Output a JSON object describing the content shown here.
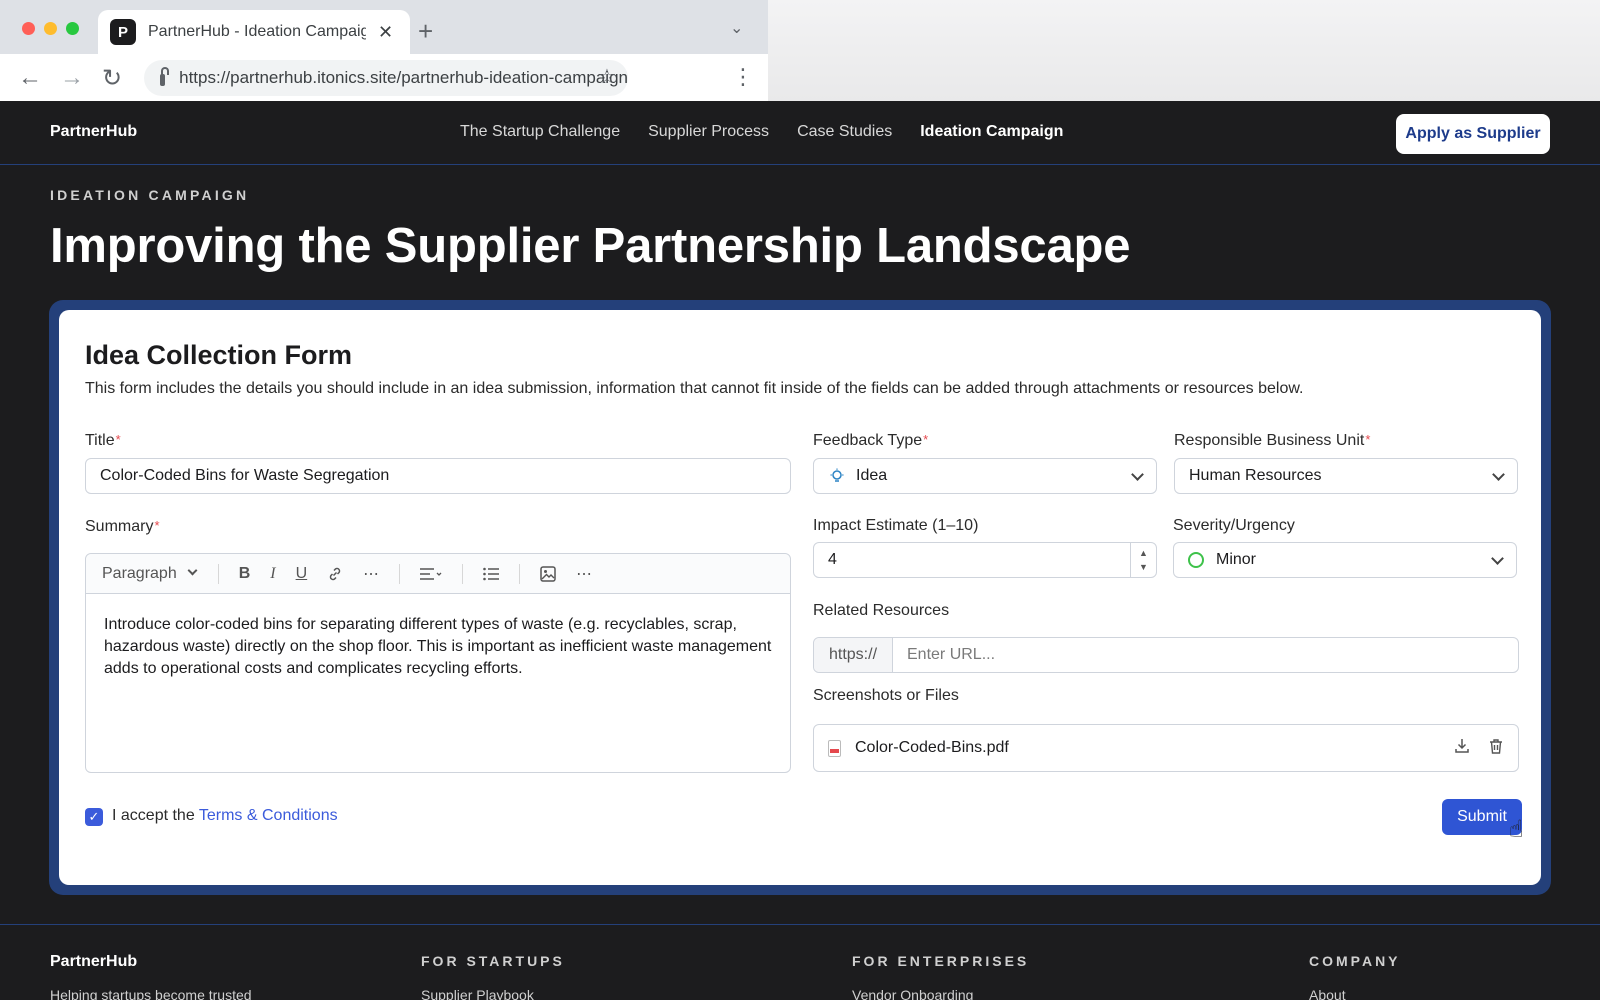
{
  "browser": {
    "tab_title": "PartnerHub - Ideation Campaign",
    "tab_favicon": "P",
    "url": "https://partnerhub.itonics.site/partnerhub-ideation-campaign"
  },
  "header": {
    "brand": "PartnerHub",
    "nav": [
      "The Startup Challenge",
      "Supplier Process",
      "Case Studies",
      "Ideation Campaign"
    ],
    "active_nav": "Ideation Campaign",
    "cta": "Apply as Supplier"
  },
  "hero": {
    "eyebrow": "IDEATION CAMPAIGN",
    "title": "Improving the Supplier Partnership Landscape"
  },
  "form": {
    "title": "Idea Collection Form",
    "description": "This form includes the details you should include in an idea submission, information that cannot fit inside of the fields can be added through attachments or resources below.",
    "title_field": {
      "label": "Title",
      "required_mark": "*",
      "value": "Color-Coded Bins for Waste Segregation"
    },
    "summary": {
      "label": "Summary",
      "required_mark": "*",
      "paragraph_style": "Paragraph",
      "text": "Introduce color-coded bins for separating different types of waste (e.g. recyclables, scrap, hazardous waste) directly on the shop floor. This is important as inefficient waste management adds to operational costs and complicates recycling efforts."
    },
    "feedback_type": {
      "label": "Feedback Type",
      "required_mark": "*",
      "value": "Idea",
      "icon": "lightbulb-icon"
    },
    "business_unit": {
      "label": "Responsible Business Unit",
      "required_mark": "*",
      "value": "Human Resources"
    },
    "impact": {
      "label": "Impact Estimate (1–10)",
      "value": "4"
    },
    "severity": {
      "label": "Severity/Urgency",
      "value": "Minor",
      "status_color": "#3ec24a"
    },
    "resources": {
      "label": "Related Resources",
      "prefix": "https://",
      "placeholder": "Enter URL..."
    },
    "files": {
      "label": "Screenshots or Files",
      "file_name": "Color-Coded-Bins.pdf"
    },
    "terms": {
      "prefix": "I accept the ",
      "link": "Terms & Conditions",
      "checked": true
    },
    "submit": "Submit"
  },
  "footer": {
    "brand": "PartnerHub",
    "tagline": "Helping startups become trusted",
    "columns": [
      {
        "title": "FOR STARTUPS",
        "link": "Supplier Playbook"
      },
      {
        "title": "FOR ENTERPRISES",
        "link": "Vendor Onboarding"
      },
      {
        "title": "COMPANY",
        "link": "About"
      }
    ]
  },
  "colors": {
    "accent": "#2f55d4",
    "frame": "#24407a",
    "background": "#1c1c1e"
  }
}
